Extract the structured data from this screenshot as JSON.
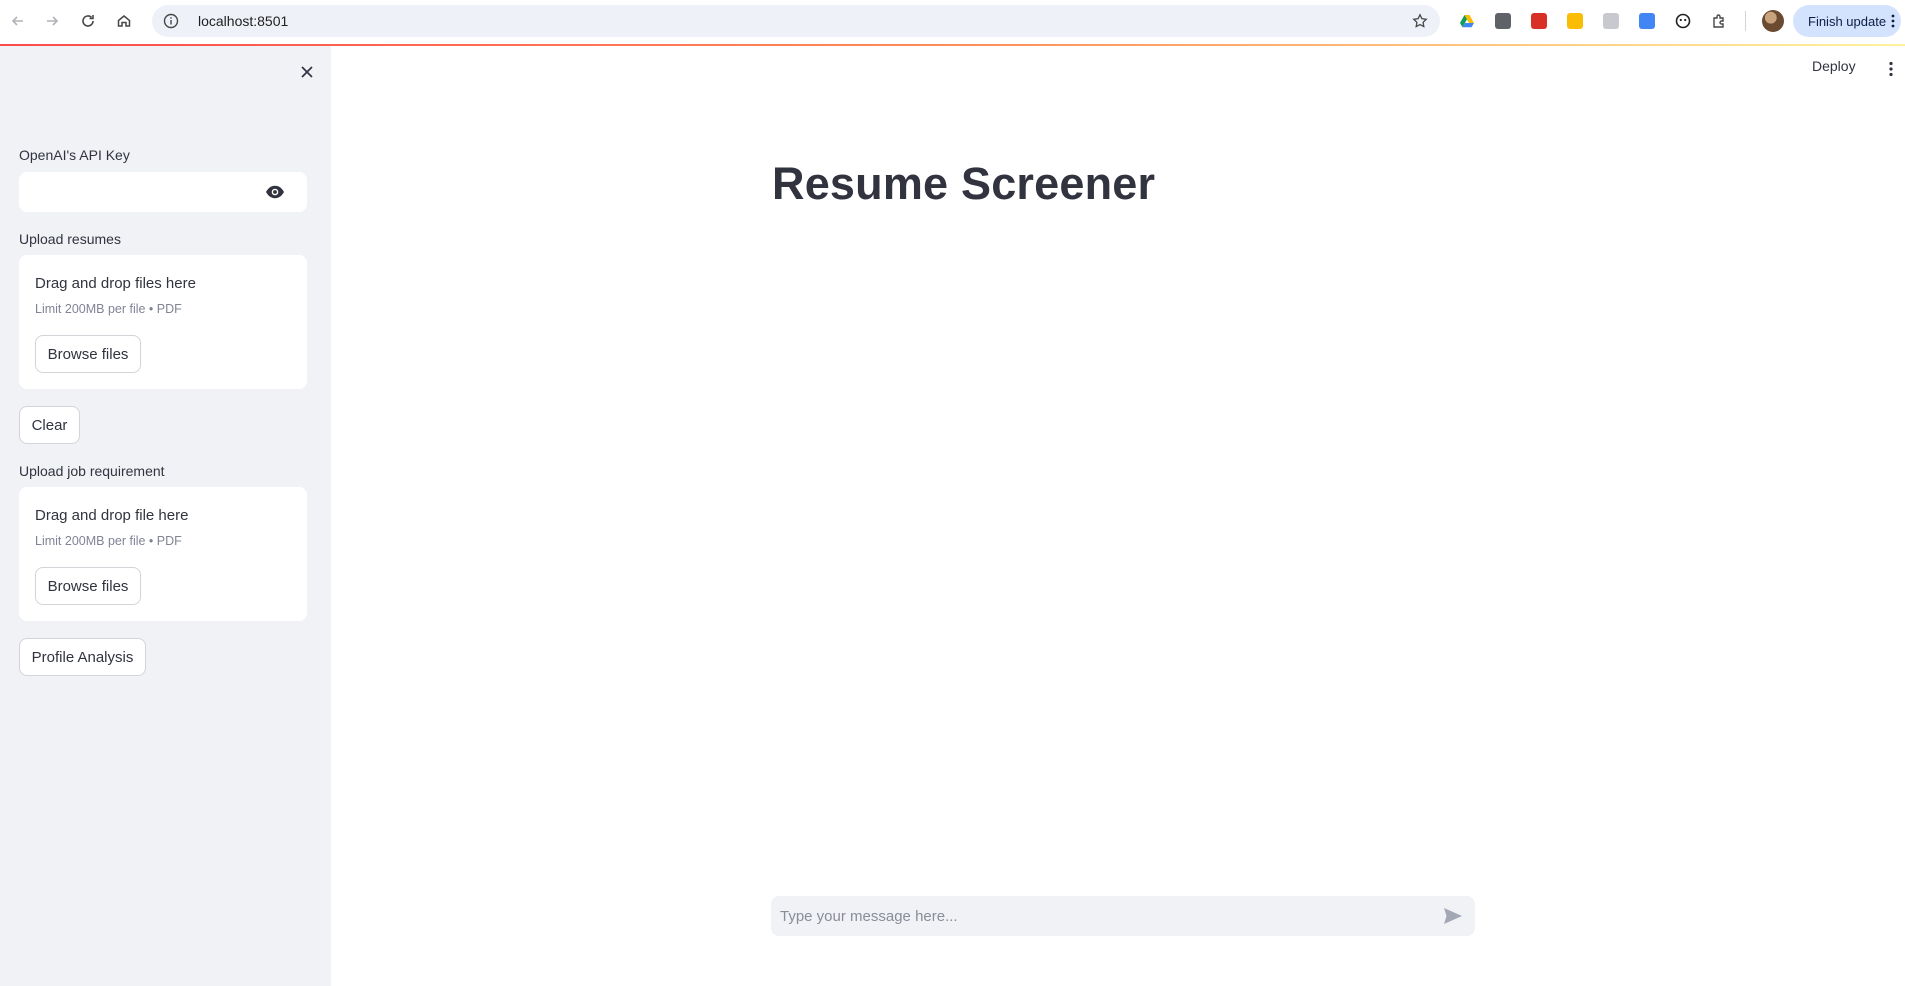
{
  "browser": {
    "url": "localhost:8501",
    "finish_update_label": "Finish update",
    "extensions": [
      "drive-icon",
      "grid-extension-icon",
      "red-book-icon",
      "keep-icon",
      "calendar-icon",
      "translate-icon",
      "smiley-icon",
      "puzzle-icon"
    ]
  },
  "sidebar": {
    "api_key_label": "OpenAI's API Key",
    "api_key_value": "",
    "upload_resumes_label": "Upload resumes",
    "resumes_drop_title": "Drag and drop files here",
    "resumes_drop_limit": "Limit 200MB per file • PDF",
    "resumes_browse_label": "Browse files",
    "clear_label": "Clear",
    "upload_job_label": "Upload job requirement",
    "job_drop_title": "Drag and drop file here",
    "job_drop_limit": "Limit 200MB per file • PDF",
    "job_browse_label": "Browse files",
    "profile_analysis_label": "Profile Analysis"
  },
  "header": {
    "deploy_label": "Deploy"
  },
  "main": {
    "title": "Resume Screener",
    "chat_placeholder": "Type your message here..."
  },
  "colors": {
    "sidebar_bg": "#f0f2f6",
    "text": "#31333f",
    "accent": "#ff4b4b"
  }
}
